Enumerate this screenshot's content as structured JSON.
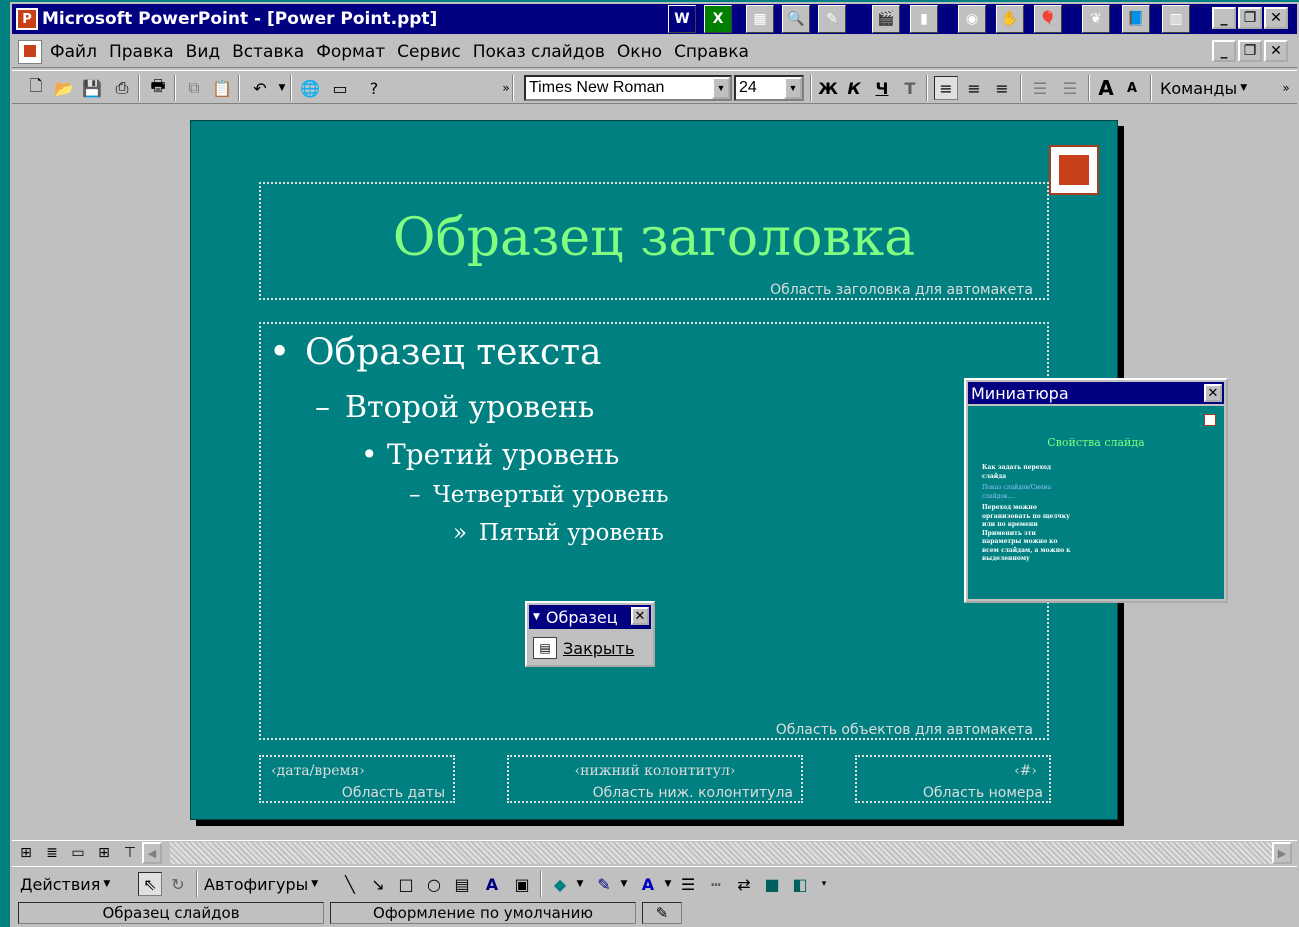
{
  "window": {
    "title": "Microsoft PowerPoint - [Power Point.ppt]",
    "app_icon_letter": "P"
  },
  "taskbar_icons": [
    "word-icon",
    "excel-icon",
    "calculator-icon",
    "search-icon",
    "notepad-icon",
    "movie-icon",
    "briefcase-icon",
    "camera-icon",
    "hand-icon",
    "balloon-icon",
    "parrot-icon",
    "book-icon",
    "chart-icon"
  ],
  "menu": {
    "items": [
      "Файл",
      "Правка",
      "Вид",
      "Вставка",
      "Формат",
      "Сервис",
      "Показ слайдов",
      "Окно",
      "Справка"
    ]
  },
  "formatting": {
    "font": "Times New Roman",
    "size": "24",
    "bold": "Ж",
    "italic": "К",
    "underline": "Ч",
    "shadow": "Т",
    "commands": "Команды"
  },
  "slide": {
    "title": "Образец заголовка",
    "title_area_label": "Область заголовка для автомакета",
    "levels": [
      "Образец текста",
      "Второй уровень",
      "Третий уровень",
      "Четвертый уровень",
      "Пятый уровень"
    ],
    "bullets": [
      "•",
      "–",
      "•",
      "–",
      "»"
    ],
    "objects_area_label": "Область объектов для автомакета",
    "date_text": "‹дата/время›",
    "date_label": "Область даты",
    "footer_text": "‹нижний колонтитул›",
    "footer_label": "Область ниж. колонтитула",
    "number_text": "‹#›",
    "number_label": "Область номера",
    "colors": {
      "background": "#008080",
      "title": "#80ff80",
      "text": "#ffffff"
    }
  },
  "miniature": {
    "title": "Миниатюра",
    "slide_title": "Свойства слайда",
    "lines": [
      "Как задать переход",
      "слайда",
      "Показ слайдов/Смена",
      "слайдов....",
      "Переход можно",
      "организовать по щелчку",
      "или по времени",
      "Применить эти",
      "параметры можно ко",
      "всем слайдам, а можно к",
      "выделенному"
    ]
  },
  "obrazets_toolbar": {
    "title": "Образец",
    "close_label": "Закрыть"
  },
  "drawing": {
    "actions": "Действия",
    "autoshapes": "Автофигуры"
  },
  "status": {
    "panel1": "Образец слайдов",
    "panel2": "Оформление по умолчанию"
  }
}
